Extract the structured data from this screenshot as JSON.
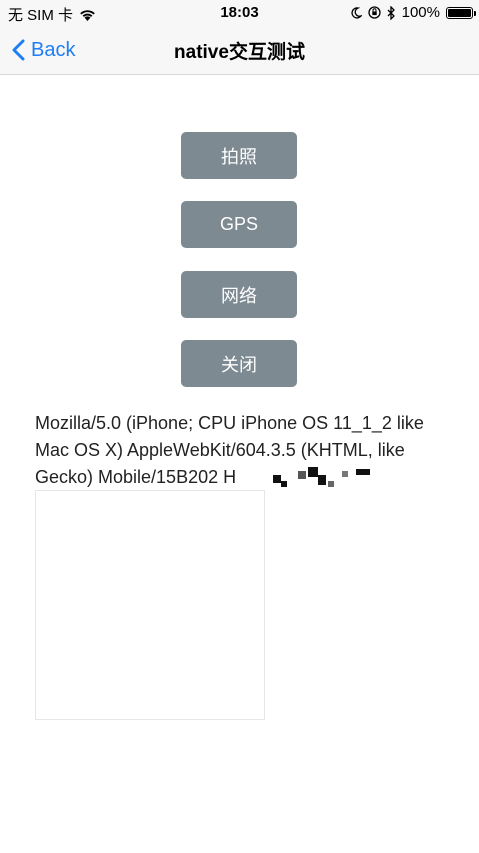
{
  "status_bar": {
    "carrier": "无 SIM 卡",
    "time": "18:03",
    "battery_percent": "100%"
  },
  "nav": {
    "back_label": "Back",
    "title": "native交互测试"
  },
  "buttons": {
    "photo": "拍照",
    "gps": "GPS",
    "network": "网络",
    "close": "关闭"
  },
  "user_agent": "Mozilla/5.0 (iPhone; CPU iPhone OS 11_1_2 like Mac OS X) AppleWebKit/604.3.5 (KHTML, like Gecko) Mobile/15B202 H",
  "colors": {
    "accent": "#1d7ef5",
    "button_bg": "#7d8a92"
  }
}
